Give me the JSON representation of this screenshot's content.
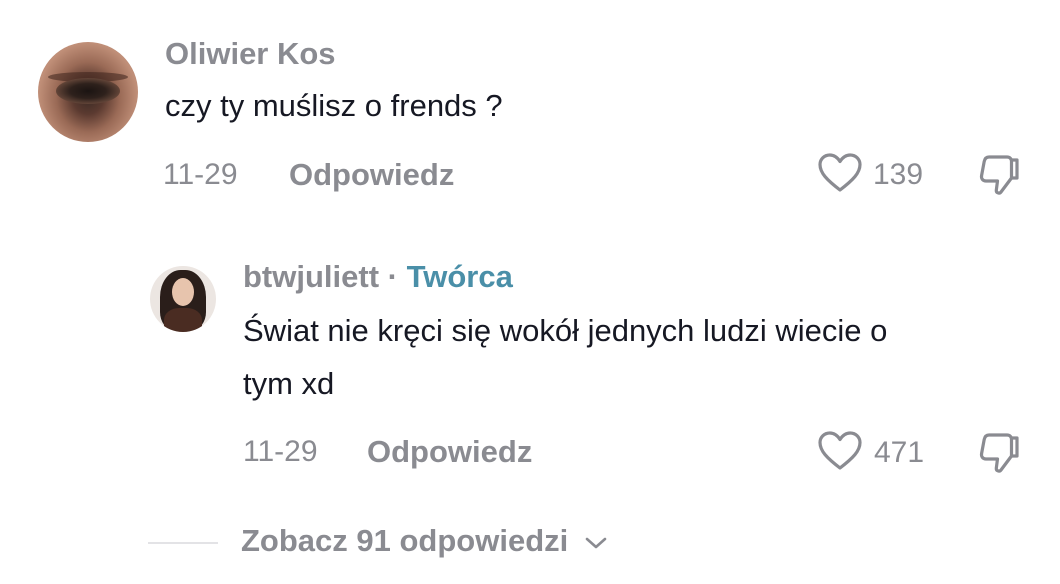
{
  "comment": {
    "username": "Oliwier Kos",
    "text": "czy ty muślisz o frends ?",
    "date": "11-29",
    "reply_label": "Odpowiedz",
    "likes": "139",
    "icons": {
      "like": "heart-outline-icon",
      "dislike": "thumbs-down-outline-icon"
    }
  },
  "reply": {
    "username": "btwjuliett",
    "separator": "·",
    "badge": "Twórca",
    "text_line1": "Świat nie kręci się wokół jednych ludzi wiecie o",
    "text_line2": "tym xd",
    "date": "11-29",
    "reply_label": "Odpowiedz",
    "likes": "471",
    "icons": {
      "like": "heart-outline-icon",
      "dislike": "thumbs-down-outline-icon"
    }
  },
  "view_more": {
    "label": "Zobacz 91 odpowiedzi",
    "icon": "chevron-down-icon"
  },
  "colors": {
    "secondary_text": "#8a8b91",
    "primary_text": "#161823",
    "creator_badge": "#4a8fa8"
  }
}
